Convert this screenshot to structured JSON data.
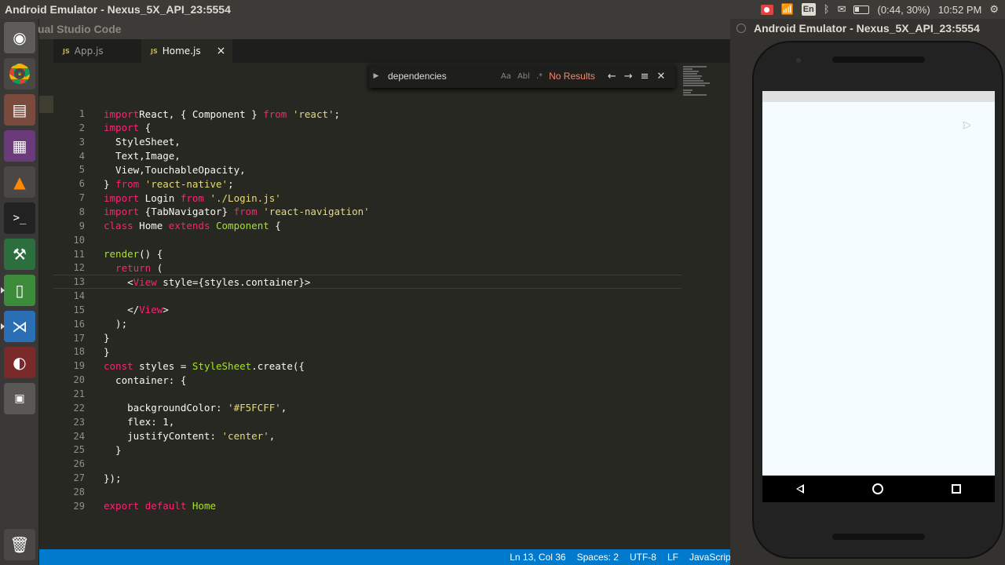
{
  "top_panel": {
    "title": "Android Emulator - Nexus_5X_API_23:5554",
    "battery": "(0:44, 30%)",
    "clock": "10:52 PM",
    "keyboard": "En"
  },
  "vscode": {
    "window_title": "ual Studio Code",
    "tabs": [
      {
        "label": "App.js",
        "icon": "JS"
      },
      {
        "label": "Home.js",
        "icon": "JS",
        "close": "×"
      }
    ],
    "find": {
      "query": "dependencies",
      "opt_case": "Aa",
      "opt_word": "Abl",
      "opt_regex": ".*",
      "result": "No Results"
    },
    "code_lines": [
      {
        "n": "1",
        "parts": [
          [
            "kw",
            "import"
          ],
          [
            "",
            "React, { Component } "
          ],
          [
            "kw",
            "from"
          ],
          [
            "st",
            " 'react'"
          ],
          [
            "",
            ";"
          ]
        ]
      },
      {
        "n": "2",
        "parts": [
          [
            "kw",
            "import"
          ],
          [
            "",
            " {"
          ]
        ]
      },
      {
        "n": "3",
        "parts": [
          [
            "",
            "  StyleSheet,"
          ]
        ]
      },
      {
        "n": "4",
        "parts": [
          [
            "",
            "  Text,Image,"
          ]
        ]
      },
      {
        "n": "5",
        "parts": [
          [
            "",
            "  View,TouchableOpacity,"
          ]
        ]
      },
      {
        "n": "6",
        "parts": [
          [
            "",
            "} "
          ],
          [
            "kw",
            "from"
          ],
          [
            "st",
            " 'react-native'"
          ],
          [
            "",
            ";"
          ]
        ]
      },
      {
        "n": "7",
        "parts": [
          [
            "kw",
            "import"
          ],
          [
            "",
            " Login "
          ],
          [
            "kw",
            "from"
          ],
          [
            "st",
            " './Login.js'"
          ]
        ]
      },
      {
        "n": "8",
        "parts": [
          [
            "kw",
            "import"
          ],
          [
            "",
            " {TabNavigator} "
          ],
          [
            "kw",
            "from"
          ],
          [
            "st",
            " 'react-navigation'"
          ]
        ]
      },
      {
        "n": "9",
        "parts": [
          [
            "kw",
            "class"
          ],
          [
            "",
            " Home "
          ],
          [
            "kw",
            "extends"
          ],
          [
            "cl",
            " Component"
          ],
          [
            "",
            " {"
          ]
        ]
      },
      {
        "n": "10",
        "parts": []
      },
      {
        "n": "11",
        "parts": [
          [
            "cl",
            "render"
          ],
          [
            "",
            "() {"
          ]
        ]
      },
      {
        "n": "12",
        "parts": [
          [
            "kw",
            "  return"
          ],
          [
            "",
            " ("
          ]
        ]
      },
      {
        "n": "13",
        "parts": [
          [
            "",
            "    <"
          ],
          [
            "kw",
            "View"
          ],
          [
            "",
            " style={styles.container}>"
          ]
        ]
      },
      {
        "n": "14",
        "parts": []
      },
      {
        "n": "15",
        "parts": [
          [
            "",
            "    </"
          ],
          [
            "kw",
            "View"
          ],
          [
            "",
            ">"
          ]
        ]
      },
      {
        "n": "16",
        "parts": [
          [
            "",
            "  );"
          ]
        ]
      },
      {
        "n": "17",
        "parts": [
          [
            "",
            "}"
          ]
        ]
      },
      {
        "n": "18",
        "parts": [
          [
            "",
            "}"
          ]
        ]
      },
      {
        "n": "19",
        "parts": [
          [
            "kw",
            "const"
          ],
          [
            "",
            " styles = "
          ],
          [
            "cl",
            "StyleSheet"
          ],
          [
            "",
            ".create({"
          ]
        ]
      },
      {
        "n": "20",
        "parts": [
          [
            "",
            "  container: {"
          ]
        ]
      },
      {
        "n": "21",
        "parts": []
      },
      {
        "n": "22",
        "parts": [
          [
            "",
            "    backgroundColor: "
          ],
          [
            "st",
            "'#F5FCFF'"
          ],
          [
            "",
            ","
          ]
        ]
      },
      {
        "n": "23",
        "parts": [
          [
            "",
            "    flex: 1,"
          ]
        ]
      },
      {
        "n": "24",
        "parts": [
          [
            "",
            "    justifyContent: "
          ],
          [
            "st",
            "'center'"
          ],
          [
            "",
            ","
          ]
        ]
      },
      {
        "n": "25",
        "parts": [
          [
            "",
            "  }"
          ]
        ]
      },
      {
        "n": "26",
        "parts": []
      },
      {
        "n": "27",
        "parts": [
          [
            "",
            "});"
          ]
        ]
      },
      {
        "n": "28",
        "parts": []
      },
      {
        "n": "29",
        "parts": [
          [
            "kw",
            "export"
          ],
          [
            "",
            " "
          ],
          [
            "kw",
            "default"
          ],
          [
            "cl",
            " Home"
          ]
        ]
      }
    ],
    "status": {
      "position": "Ln 13, Col 36",
      "spaces": "Spaces: 2",
      "encoding": "UTF-8",
      "eol": "LF",
      "language": "JavaScript"
    }
  },
  "emulator": {
    "title": "Android Emulator - Nexus_5X_API_23:5554",
    "app_background": "#F5FCFF"
  },
  "launcher": {
    "items": [
      "dash-icon",
      "chrome-icon",
      "files-icon",
      "photos-icon",
      "vlc-icon",
      "terminal-icon",
      "android-studio-icon",
      "emulator-icon",
      "vscode-icon",
      "disk-icon",
      "workspace-icon",
      "trash-icon"
    ]
  }
}
